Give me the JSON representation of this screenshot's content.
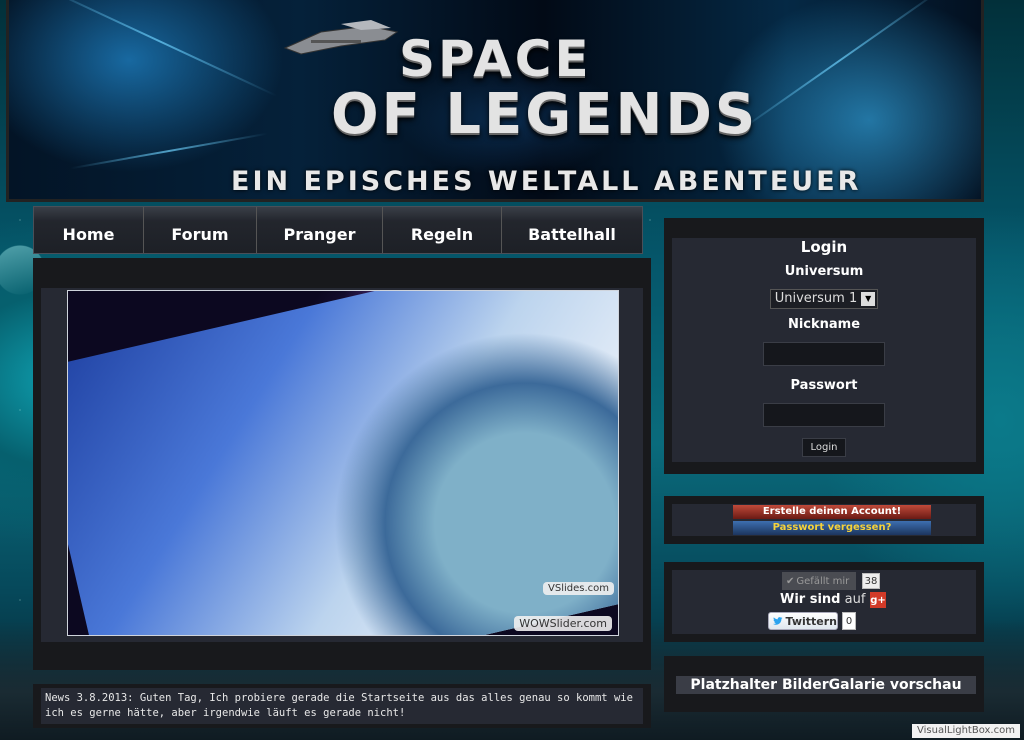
{
  "header": {
    "logo_line1": "SPACE",
    "logo_line2": "OF LEGENDS",
    "subtitle": "EIN EPISCHES WELTALL ABENTEUER"
  },
  "nav": {
    "items": [
      {
        "label": "Home"
      },
      {
        "label": "Forum"
      },
      {
        "label": "Pranger"
      },
      {
        "label": "Regeln"
      },
      {
        "label": "Battelhall"
      }
    ]
  },
  "slider": {
    "watermark_partial": "VSlides.com",
    "watermark": "WOWSlider.com"
  },
  "news": {
    "text": "News 3.8.2013: Guten Tag, Ich probiere gerade die Startseite aus das alles genau so kommt wie ich es gerne hätte, aber irgendwie läuft es gerade nicht!"
  },
  "login": {
    "title": "Login",
    "universe_label": "Universum",
    "universe_value": "Universum 1",
    "nickname_label": "Nickname",
    "password_label": "Passwort",
    "button": "Login"
  },
  "account": {
    "create": "Erstelle deinen Account!",
    "forgot": "Passwort vergessen?"
  },
  "social": {
    "like_label": "Gefällt mir",
    "like_count": "38",
    "wir_sind": "Wir sind",
    "auf": "auf",
    "gplus": "g+",
    "twitter_label": "Twittern",
    "twitter_count": "0"
  },
  "gallery": {
    "title": "Platzhalter BilderGalarie vorschau"
  },
  "footer": {
    "credit": "VisualLightBox.com"
  },
  "colors": {
    "panel": "#18191c",
    "panel_inner": "#262933",
    "create_button": "#a8382a",
    "forgot_button": "#2c5290",
    "forgot_text": "#f5d23a"
  }
}
